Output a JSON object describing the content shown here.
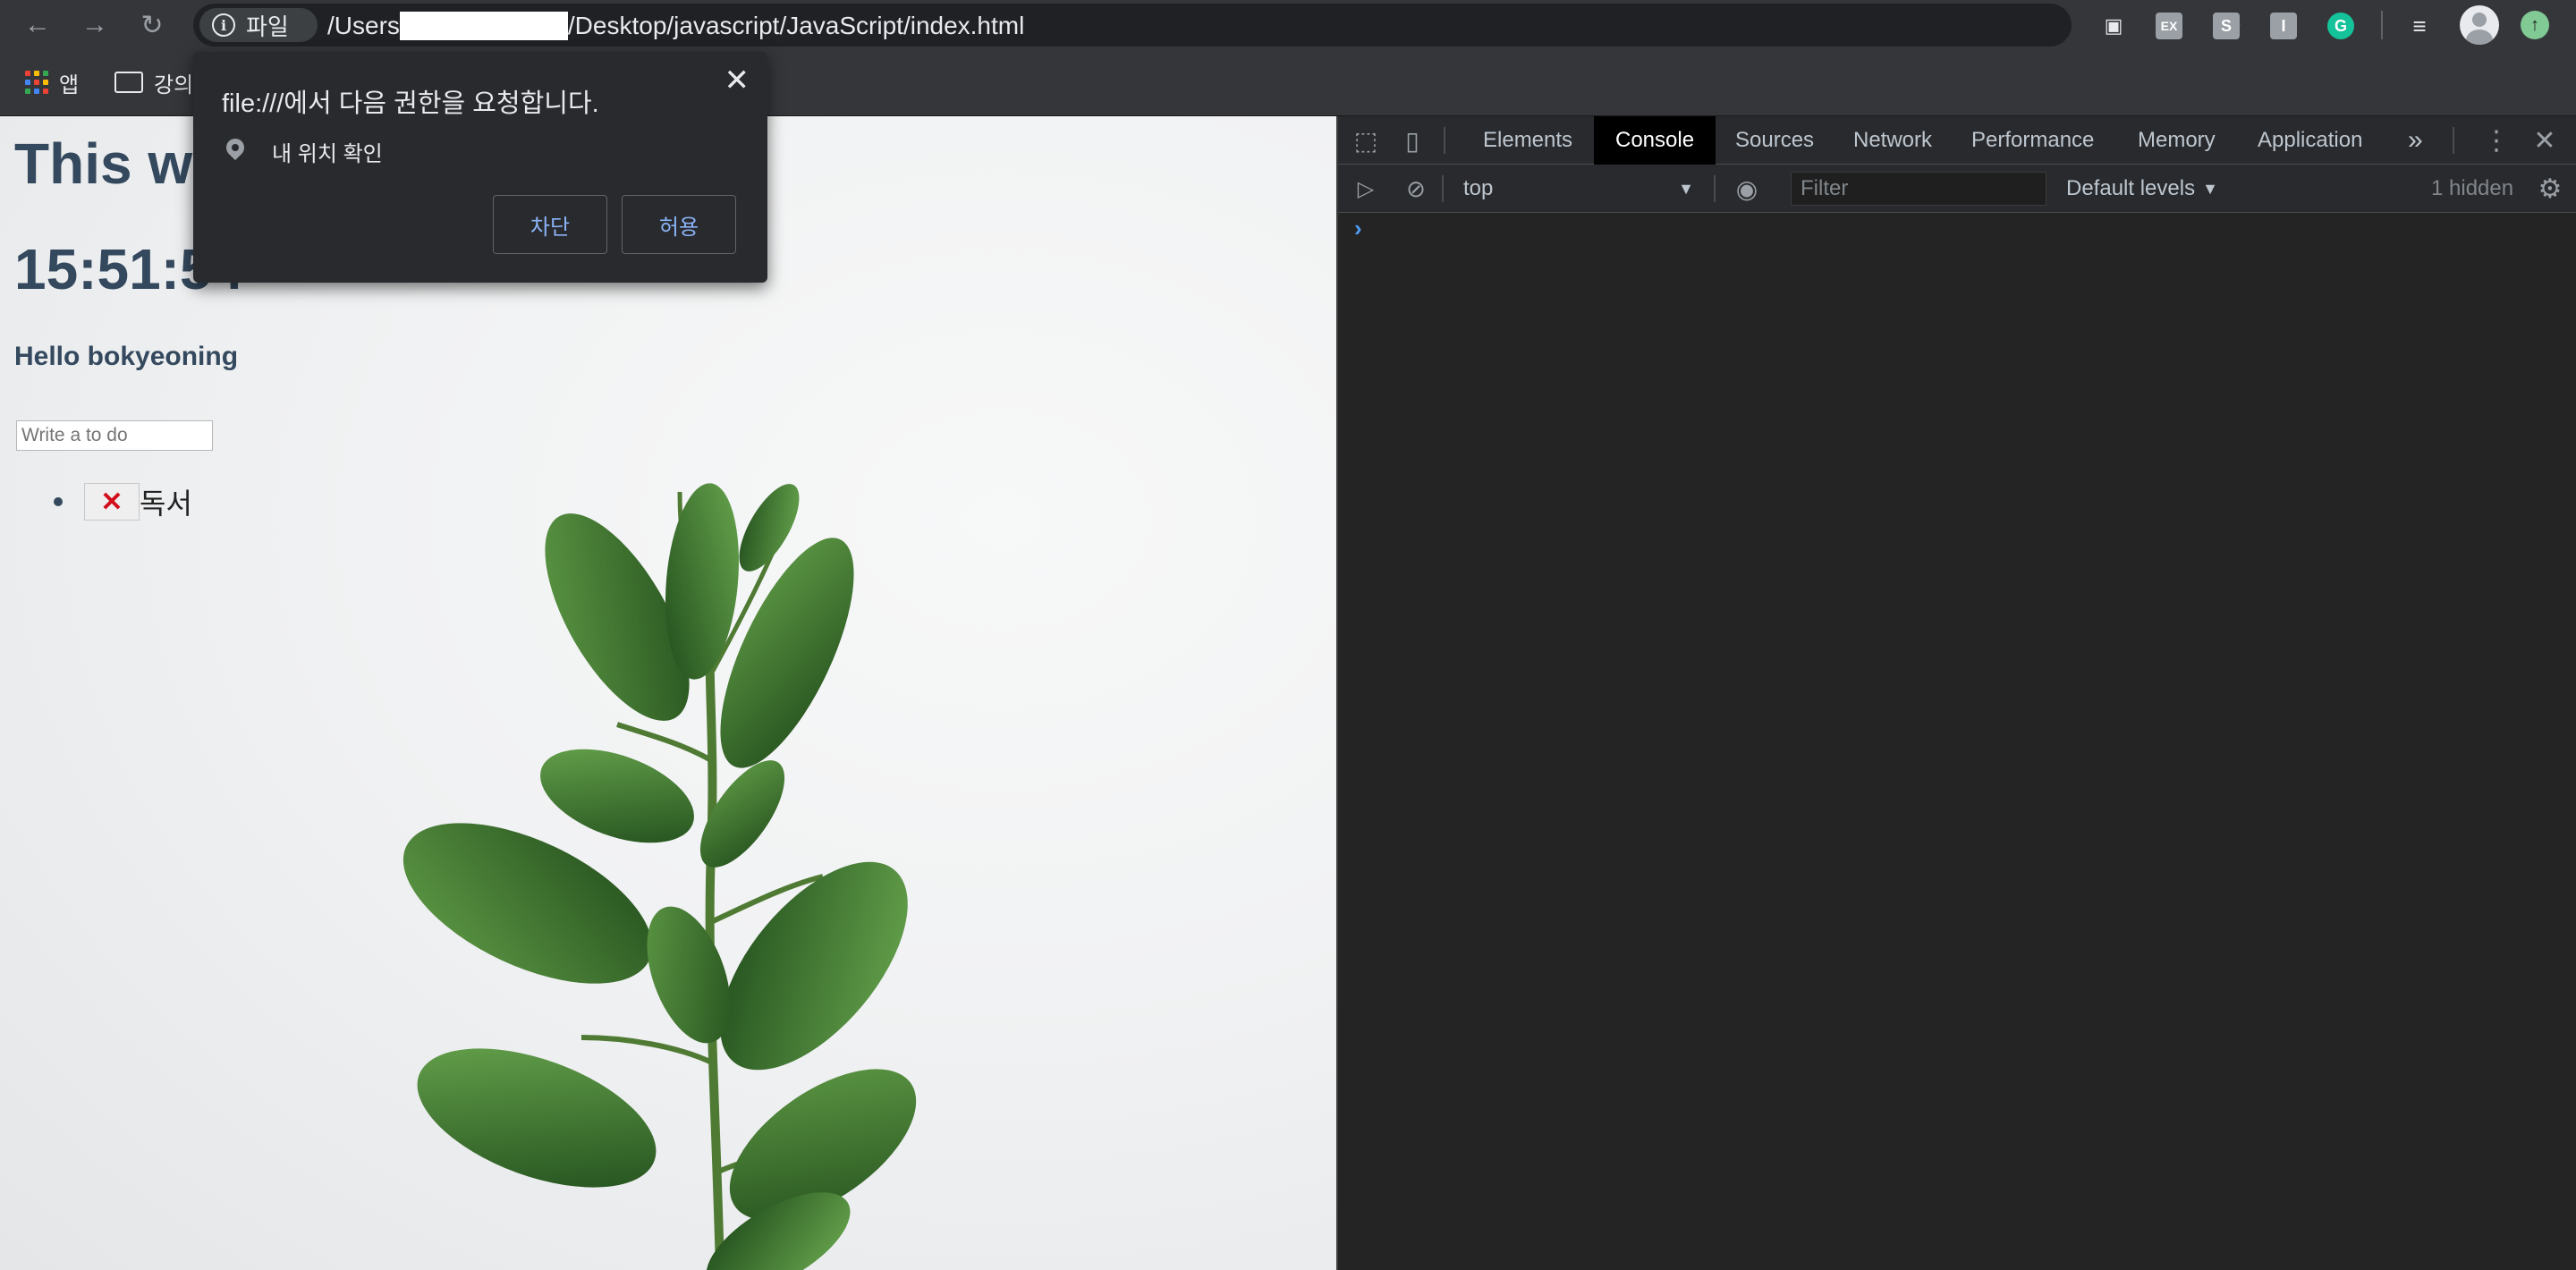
{
  "browser": {
    "site_chip_label": "파일",
    "url_prefix": "/Users",
    "url_suffix": "/Desktop/javascript/JavaScript/index.html",
    "extensions": [
      {
        "icon": "screen-icon",
        "color": "#f1f3f4"
      },
      {
        "icon": "ex-extension-icon",
        "text": "EX",
        "color": "#9aa0a6"
      },
      {
        "icon": "s-extension-icon",
        "text": "S",
        "color": "#9aa0a6"
      },
      {
        "icon": "i-extension-icon",
        "text": "I",
        "color": "#9aa0a6"
      },
      {
        "icon": "grammarly-icon",
        "text": "G",
        "color": "#15c39a"
      }
    ]
  },
  "bookmarks": [
    {
      "label": "앱"
    },
    {
      "label": "강의"
    }
  ],
  "page": {
    "title": "This wo",
    "clock": "15:51:54",
    "greeting": "Hello bokyeoning",
    "todo_placeholder": "Write a to do",
    "todos": [
      {
        "delete_label": "✕",
        "text": "독서"
      }
    ]
  },
  "permission_popup": {
    "title": "file:///에서 다음 권한을 요청합니다.",
    "permission": "내 위치 확인",
    "block_label": "차단",
    "allow_label": "허용",
    "close": "✕"
  },
  "devtools": {
    "tabs": [
      "Elements",
      "Console",
      "Sources",
      "Network",
      "Performance",
      "Memory",
      "Application"
    ],
    "active_tab": "Console",
    "more_tabs": "»",
    "context": "top",
    "filter_placeholder": "Filter",
    "levels_label": "Default levels",
    "hidden_count": "1 hidden",
    "prompt": "›"
  },
  "colors": {
    "accent_text": "#34495e",
    "link_blue": "#8ab4f8",
    "delete_red": "#d20f1c"
  }
}
